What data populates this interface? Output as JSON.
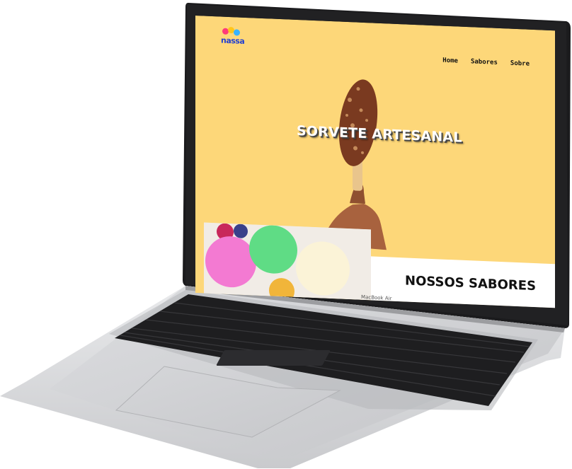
{
  "site": {
    "logo_text": "nassa",
    "nav": [
      "Home",
      "Sabores",
      "Sobre"
    ],
    "hero_title": "SORVETE ARTESANAL",
    "section_title": "NOSSOS SABORES"
  },
  "device": {
    "label": "MacBook Air"
  },
  "colors": {
    "hero_background": "#fdd779",
    "logo_blue": "#2440d0"
  }
}
